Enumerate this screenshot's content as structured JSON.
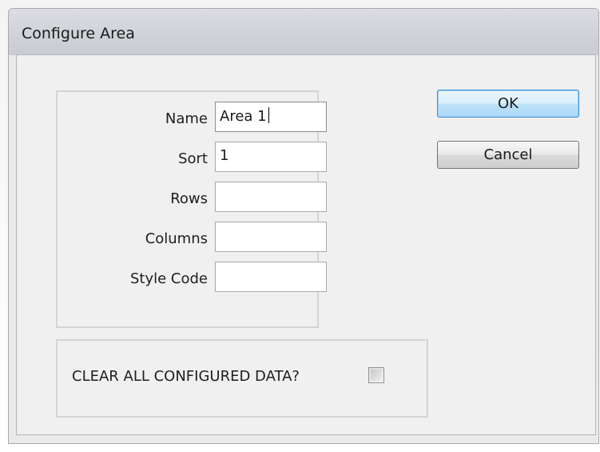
{
  "window": {
    "title": "Configure Area"
  },
  "fields": [
    {
      "label": "Name",
      "value": "Area 1"
    },
    {
      "label": "Sort",
      "value": "1"
    },
    {
      "label": "Rows",
      "value": ""
    },
    {
      "label": "Columns",
      "value": ""
    },
    {
      "label": "Style Code",
      "value": ""
    }
  ],
  "buttons": {
    "ok_label": "OK",
    "cancel_label": "Cancel"
  },
  "clear_data": {
    "label": "CLEAR ALL CONFIGURED DATA?",
    "checked": false
  },
  "colors": {
    "default_button_border": "#3c8fd6",
    "dialog_background": "#f0f0f0"
  }
}
